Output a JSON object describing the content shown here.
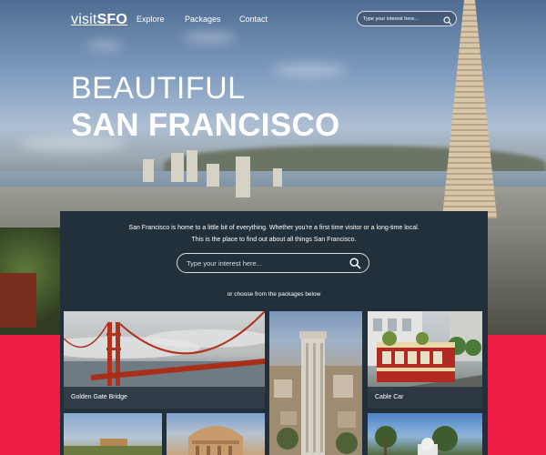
{
  "nav": {
    "logo_prefix": "visit",
    "logo_bold": "SFO",
    "links": [
      "Explore",
      "Packages",
      "Contact"
    ],
    "search_placeholder": "Type your interest here..."
  },
  "hero": {
    "line1": "BEAUTIFUL",
    "line2": "SAN FRANCISCO"
  },
  "panel": {
    "intro_line1": "San Francisco is home to a little bit of everything. Whether you're a first time visitor or a long-time local.",
    "intro_line2": "This is the place to find out about all things San Francisco.",
    "search_placeholder": "Type your interest here...",
    "choose_text": "or choose from the packages below"
  },
  "packages": [
    {
      "label": "Golden Gate Bridge"
    },
    {
      "label": ""
    },
    {
      "label": "Cable Car"
    }
  ],
  "colors": {
    "accent": "#ef1d45",
    "panel": "#22303c"
  },
  "icons": {
    "search": "search-icon"
  }
}
